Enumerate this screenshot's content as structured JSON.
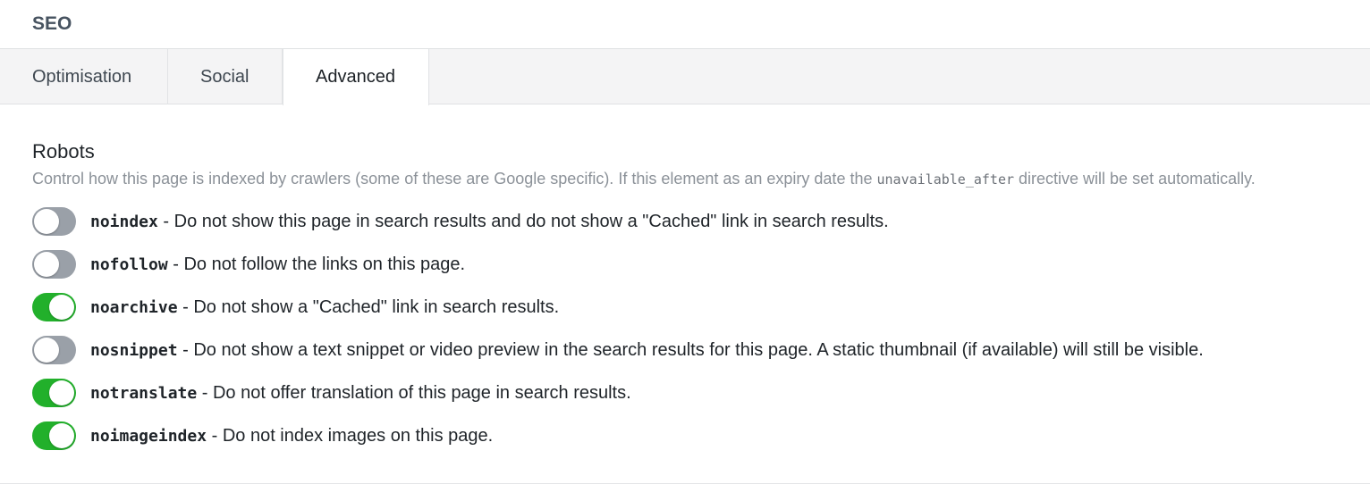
{
  "panel": {
    "title": "SEO"
  },
  "tabs": [
    {
      "label": "Optimisation",
      "active": false
    },
    {
      "label": "Social",
      "active": false
    },
    {
      "label": "Advanced",
      "active": true
    }
  ],
  "robots": {
    "label": "Robots",
    "help_before": "Control how this page is indexed by crawlers (some of these are Google specific). If this element as an expiry date the ",
    "help_code": "unavailable_after",
    "help_after": " directive will be set automatically.",
    "options": [
      {
        "key": "noindex",
        "description": " - Do not show this page in search results and do not show a \"Cached\" link in search results.",
        "enabled": false
      },
      {
        "key": "nofollow",
        "description": " - Do not follow the links on this page.",
        "enabled": false
      },
      {
        "key": "noarchive",
        "description": " - Do not show a \"Cached\" link in search results.",
        "enabled": true
      },
      {
        "key": "nosnippet",
        "description": " - Do not show a text snippet or video preview in the search results for this page. A static thumbnail (if available) will still be visible.",
        "enabled": false
      },
      {
        "key": "notranslate",
        "description": " - Do not offer translation of this page in search results.",
        "enabled": true
      },
      {
        "key": "noimageindex",
        "description": " - Do not index images on this page.",
        "enabled": true
      }
    ]
  },
  "colors": {
    "toggle_on": "#22b02b",
    "toggle_off": "#9aa0a8",
    "tab_background": "#f4f4f5"
  }
}
